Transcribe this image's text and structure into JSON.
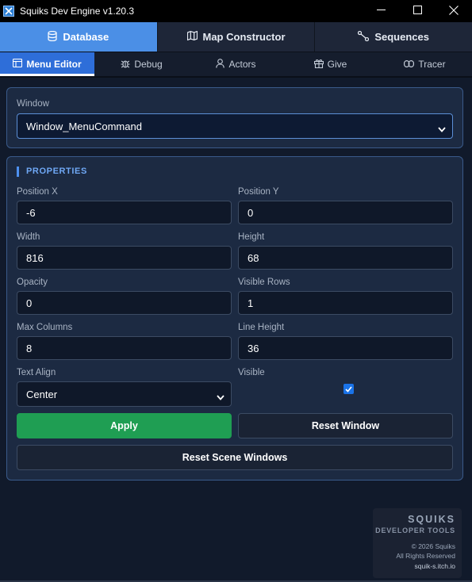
{
  "app": {
    "title": "Squiks Dev Engine v1.20.3"
  },
  "main_tabs": [
    {
      "label": "Database",
      "icon": "database-icon",
      "active": true
    },
    {
      "label": "Map Constructor",
      "icon": "map-icon",
      "active": false
    },
    {
      "label": "Sequences",
      "icon": "nodes-icon",
      "active": false
    }
  ],
  "sub_tabs": [
    {
      "label": "Menu Editor",
      "icon": "window-icon",
      "active": true
    },
    {
      "label": "Debug",
      "icon": "bug-icon",
      "active": false
    },
    {
      "label": "Actors",
      "icon": "user-icon",
      "active": false
    },
    {
      "label": "Give",
      "icon": "gift-icon",
      "active": false
    },
    {
      "label": "Tracer",
      "icon": "link-icon",
      "active": false
    }
  ],
  "window_select": {
    "label": "Window",
    "value": "Window_MenuCommand"
  },
  "properties": {
    "title": "PROPERTIES",
    "fields": {
      "position_x": {
        "label": "Position X",
        "value": "-6"
      },
      "position_y": {
        "label": "Position Y",
        "value": "0"
      },
      "width": {
        "label": "Width",
        "value": "816"
      },
      "height": {
        "label": "Height",
        "value": "68"
      },
      "opacity": {
        "label": "Opacity",
        "value": "0"
      },
      "visible_rows": {
        "label": "Visible Rows",
        "value": "1"
      },
      "max_columns": {
        "label": "Max Columns",
        "value": "8"
      },
      "line_height": {
        "label": "Line Height",
        "value": "36"
      },
      "text_align": {
        "label": "Text Align",
        "value": "Center"
      },
      "visible": {
        "label": "Visible",
        "checked": true
      }
    },
    "buttons": {
      "apply": "Apply",
      "reset_window": "Reset Window",
      "reset_scene": "Reset Scene Windows"
    }
  },
  "branding": {
    "name": "SQUIKS",
    "subtitle": "DEVELOPER TOOLS",
    "copyright": "© 2026 Squiks",
    "rights": "All Rights Reserved",
    "url": "squik-s.itch.io"
  },
  "colors": {
    "accent": "#4b8fe6",
    "apply": "#1f9e53",
    "panel": "#1c2a42",
    "background": "#111a2b"
  }
}
